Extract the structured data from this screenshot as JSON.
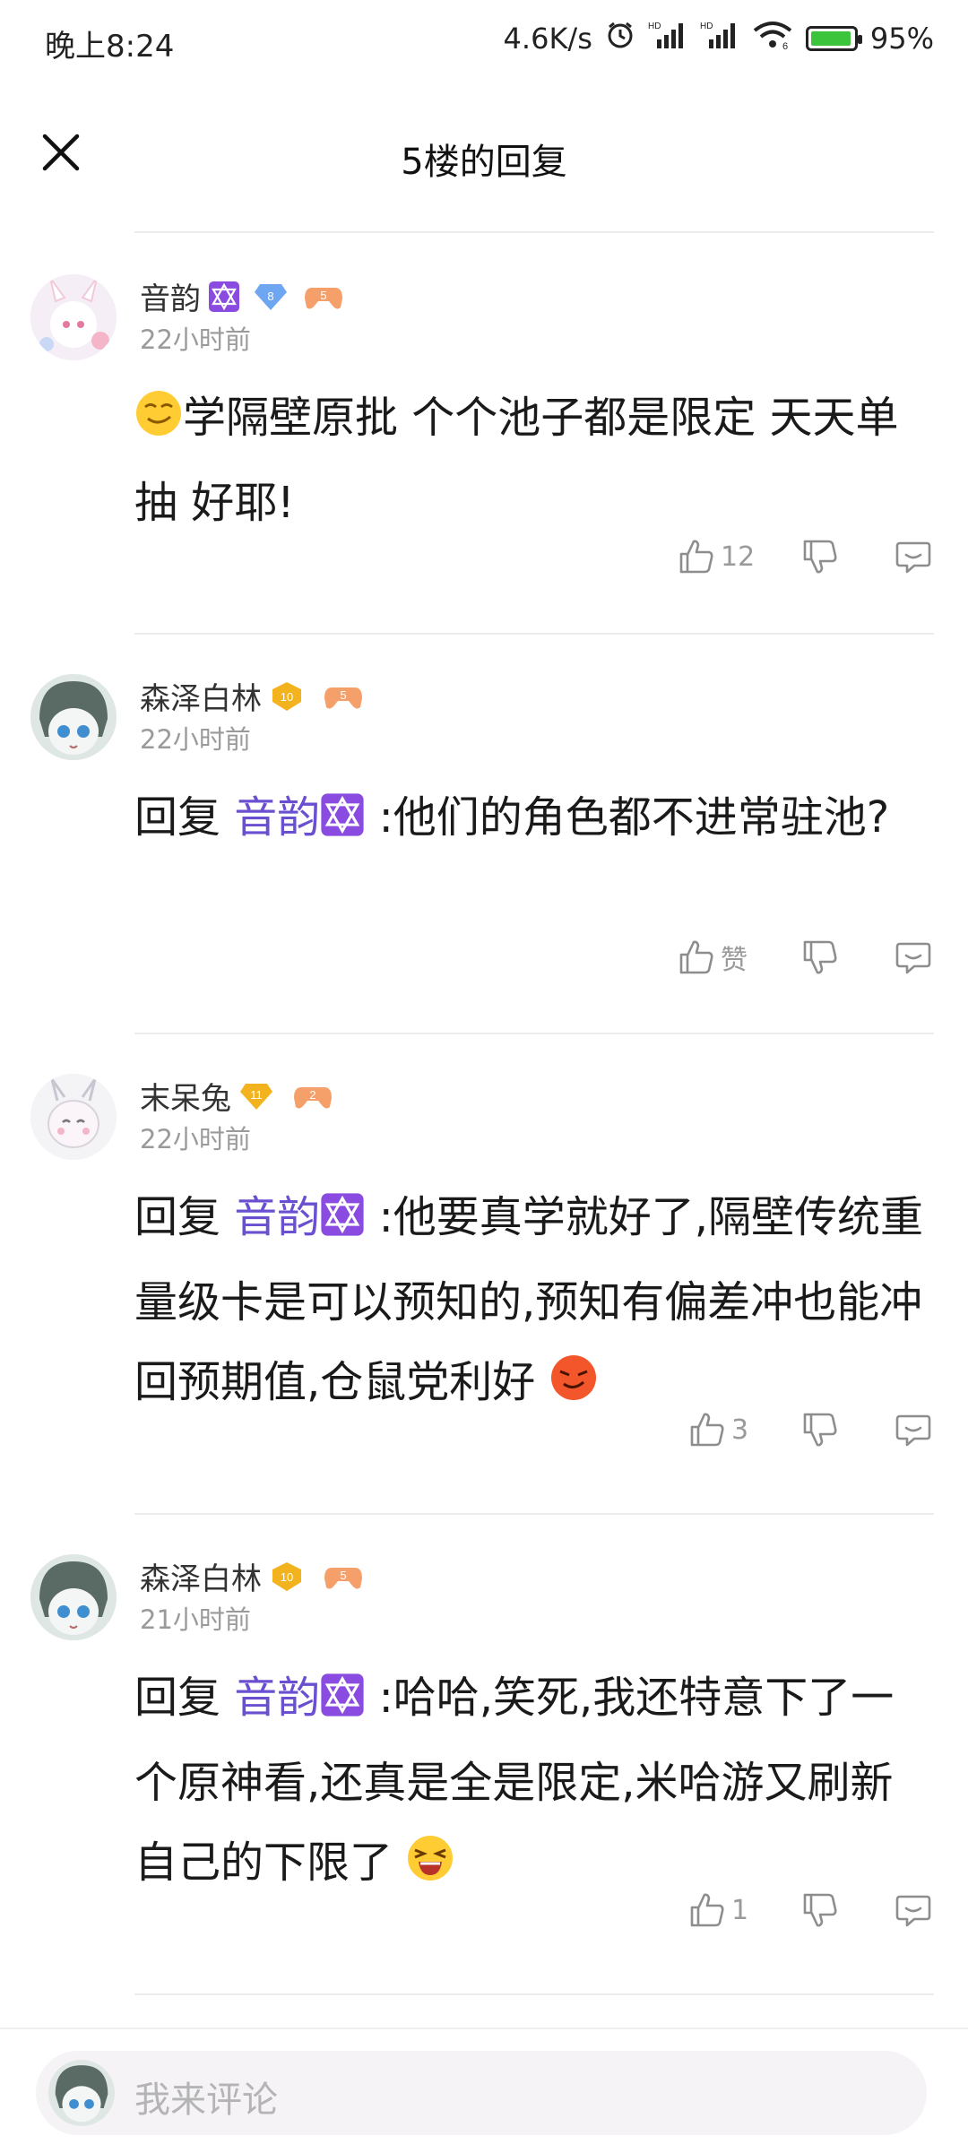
{
  "status_bar": {
    "time": "晚上8:24",
    "net_speed": "4.6K/s",
    "signal_label_1": "HD",
    "signal_label_2": "HD",
    "wifi_sub": "6",
    "battery": "95%",
    "battery_level": 0.95
  },
  "header": {
    "title": "5楼的回复",
    "close_icon": "close-icon"
  },
  "comments": [
    {
      "username": "音韵",
      "name_emoji": "star-of-david",
      "level": "8",
      "game_level": "5",
      "time": "22小时前",
      "reply_prefix": "",
      "mention": "",
      "text": "学隔壁原批 个个池子都是限定 天天单抽 好耶!",
      "leading_emoji": "smirk-face",
      "trailing_emoji": "",
      "likes": "12"
    },
    {
      "username": "森泽白林",
      "level": "10",
      "game_level": "5",
      "time": "22小时前",
      "reply_prefix": "回复",
      "mention": "音韵",
      "text": ":他们的角色都不进常驻池?",
      "trailing_emoji": "",
      "likes": "赞"
    },
    {
      "username": "末呆兔",
      "level": "11",
      "game_level": "2",
      "time": "22小时前",
      "reply_prefix": "回复",
      "mention": "音韵",
      "text": ":他要真学就好了,隔壁传统重量级卡是可以预知的,预知有偏差冲也能冲回预期值,仓鼠党利好",
      "trailing_emoji": "smug-red-face",
      "likes": "3"
    },
    {
      "username": "森泽白林",
      "level": "10",
      "game_level": "5",
      "time": "21小时前",
      "reply_prefix": "回复",
      "mention": "音韵",
      "text": ":哈哈,笑死,我还特意下了一个原神看,还真是全是限定,米哈游又刷新自己的下限了",
      "trailing_emoji": "laughing-face",
      "likes": "1"
    }
  ],
  "bottom_bar": {
    "placeholder": "我来评论"
  },
  "colors": {
    "mention": "#6a4fd0",
    "star_badge": "#7b3fd6",
    "gold_badge": "#f2b31e",
    "blue_badge": "#6fa6f2",
    "game_badge": "#f28a4a"
  }
}
